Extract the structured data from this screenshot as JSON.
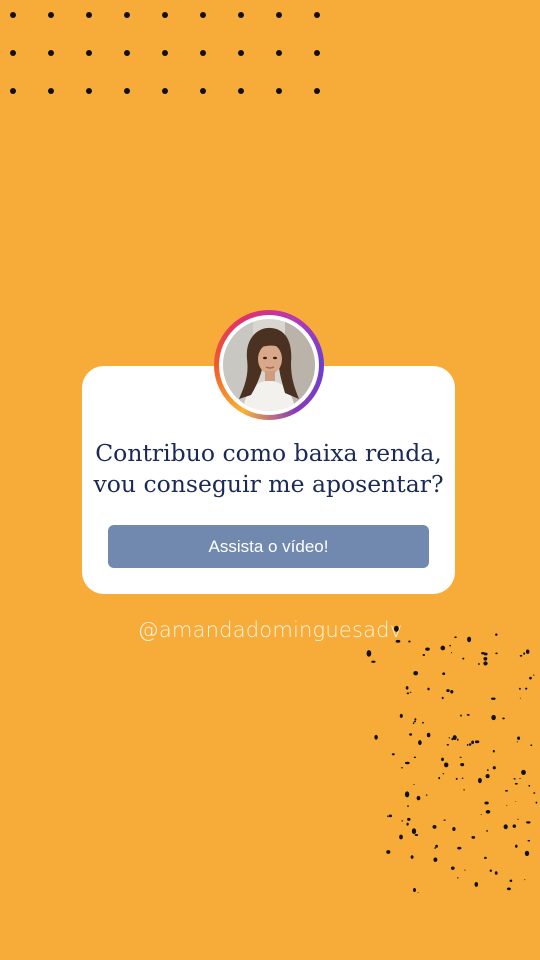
{
  "story": {
    "question_lines": [
      "Contribuo como baixa renda,",
      "vou conseguir me aposentar?"
    ],
    "button_label": "Assista o vídeo!",
    "handle": "@amandadominguesadv"
  },
  "colors": {
    "background": "#F7AC3A",
    "card": "#FFFFFF",
    "question_text": "#1B2A55",
    "button": "#7189AE",
    "button_text": "#FFFFFF",
    "handle_text": "#FFF3DF",
    "dots": "#111111"
  },
  "icons": {
    "avatar": "profile-photo",
    "decoration_top": "dot-grid",
    "decoration_bottom": "ink-speckles"
  }
}
